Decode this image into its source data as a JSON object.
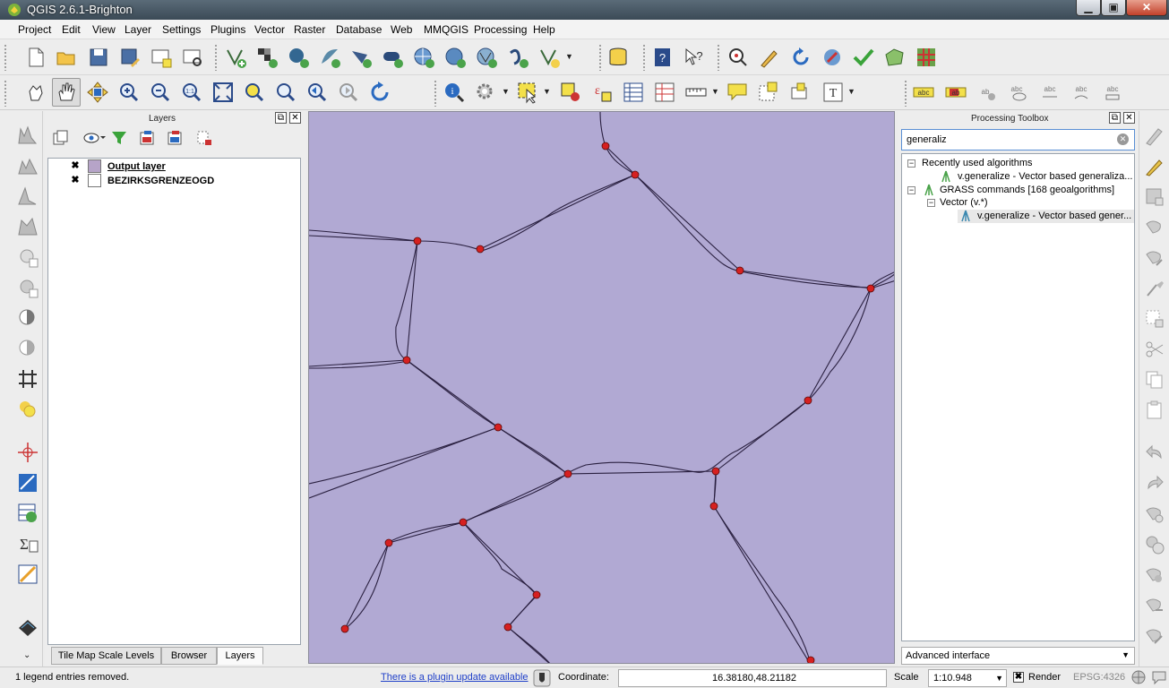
{
  "window": {
    "title": "QGIS 2.6.1-Brighton"
  },
  "menu": [
    "Project",
    "Edit",
    "View",
    "Layer",
    "Settings",
    "Plugins",
    "Vector",
    "Raster",
    "Database",
    "Web",
    "MMQGIS",
    "Processing",
    "Help"
  ],
  "layers_panel": {
    "title": "Layers",
    "layers": [
      {
        "name": "Output layer",
        "checked": "✖",
        "swatch_color": "#b6a4c8"
      },
      {
        "name": "BEZIRKSGRENZEOGD",
        "checked": "✖",
        "swatch_color": "#ffffff"
      }
    ],
    "tabs": [
      "Tile Map Scale Levels",
      "Browser",
      "Layers"
    ]
  },
  "processing_toolbox": {
    "title": "Processing Toolbox",
    "search_value": "generaliz",
    "tree": {
      "recent_group": "Recently used algorithms",
      "recent_item": "v.generalize - Vector based generaliza...",
      "grass_group": "GRASS commands [168 geoalgorithms]",
      "vector_group": "Vector (v.*)",
      "vector_item": "v.generalize - Vector based gener..."
    },
    "interface_mode": "Advanced interface"
  },
  "statusbar": {
    "message": "1 legend entries removed.",
    "plugin_update": "There is a plugin update available",
    "coordinate_label": "Coordinate:",
    "coordinate_value": "16.38180,48.21182",
    "scale_label": "Scale",
    "scale_value": "1:10.948",
    "render_label": "Render",
    "render_checked": "✖",
    "crs": "EPSG:4326"
  },
  "colors": {
    "map_background": "#b1a9d3",
    "vertex": "#d62020",
    "line": "#2a2040"
  }
}
